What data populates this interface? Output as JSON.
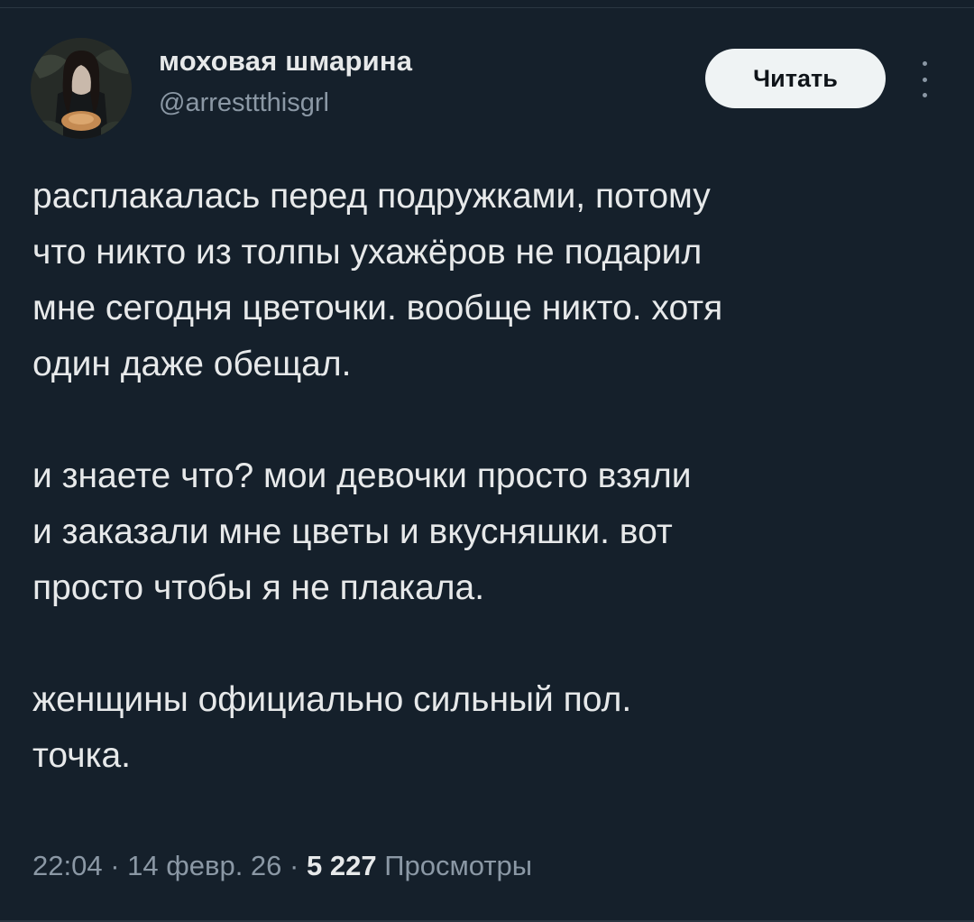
{
  "author": {
    "display_name": "моховая шмарина",
    "handle": "@arresttthisgrl"
  },
  "follow_button_label": "Читать",
  "more_icon": "more-vertical-icon",
  "tweet": {
    "lines": [
      "расплакалась перед подружками, потому",
      "что никто из толпы ухажёров не подарил",
      "мне сегодня цветочки. вообще никто. хотя",
      "один даже обещал.",
      "",
      "и знаете что? мои девочки просто взяли",
      "и заказали мне цветы и вкусняшки. вот",
      "просто чтобы я не плакала.",
      "",
      "женщины официально сильный пол.",
      "точка."
    ]
  },
  "meta": {
    "time": "22:04",
    "separator": "·",
    "date": "14 февр. 26",
    "views_count": "5 227",
    "views_label": "Просмотры"
  },
  "colors": {
    "background": "#15202b",
    "text_primary": "#e7e9ea",
    "text_secondary": "#8b98a5",
    "button_bg": "#eff3f4"
  }
}
